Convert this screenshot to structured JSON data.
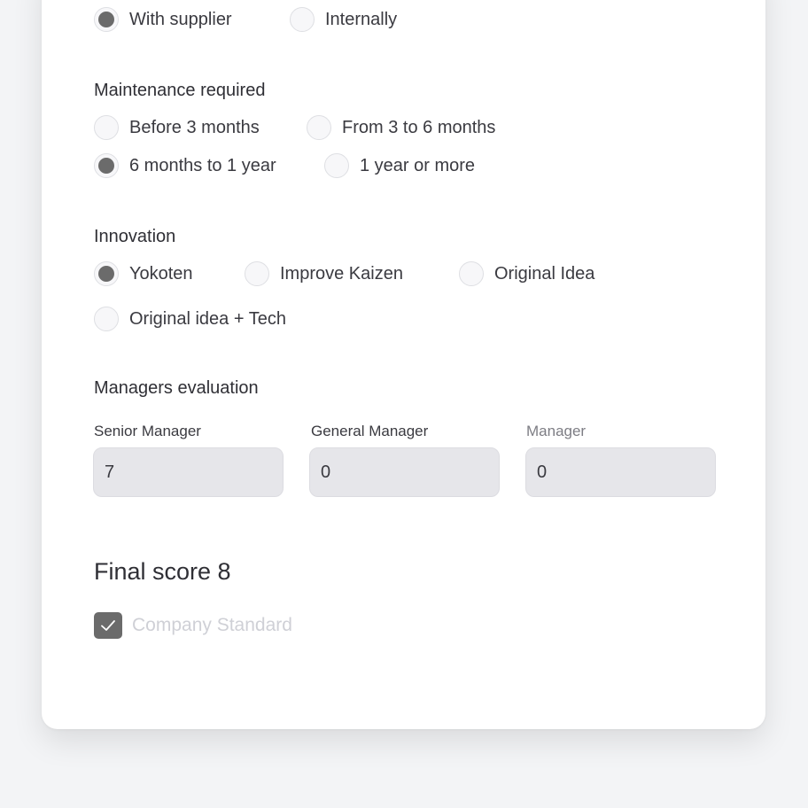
{
  "repair_location": {
    "options": [
      {
        "label": "With supplier",
        "checked": true
      },
      {
        "label": "Internally",
        "checked": false
      }
    ]
  },
  "maintenance": {
    "title": "Maintenance required",
    "options": [
      {
        "label": "Before 3 months",
        "checked": false
      },
      {
        "label": "From 3 to 6 months",
        "checked": false
      },
      {
        "label": "6 months to 1 year",
        "checked": true
      },
      {
        "label": "1 year or more",
        "checked": false
      }
    ]
  },
  "innovation": {
    "title": "Innovation",
    "options": [
      {
        "label": "Yokoten",
        "checked": true
      },
      {
        "label": "Improve Kaizen",
        "checked": false
      },
      {
        "label": "Original Idea",
        "checked": false
      },
      {
        "label": "Original idea + Tech",
        "checked": false
      }
    ]
  },
  "managers_evaluation": {
    "title": "Managers evaluation",
    "fields": [
      {
        "label": "Senior Manager",
        "value": "7"
      },
      {
        "label": "General Manager",
        "value": "0"
      },
      {
        "label": "Manager",
        "value": "0"
      }
    ]
  },
  "final_score": {
    "text": "Final score 8"
  },
  "company_standard": {
    "label": "Company Standard",
    "checked": true
  },
  "colors": {
    "page_background": "#f3f4f6",
    "card_background": "#ffffff",
    "selected_radio": "#6b6b6b",
    "input_background": "#e6e6ea",
    "disabled_text": "#cfd0d6"
  }
}
